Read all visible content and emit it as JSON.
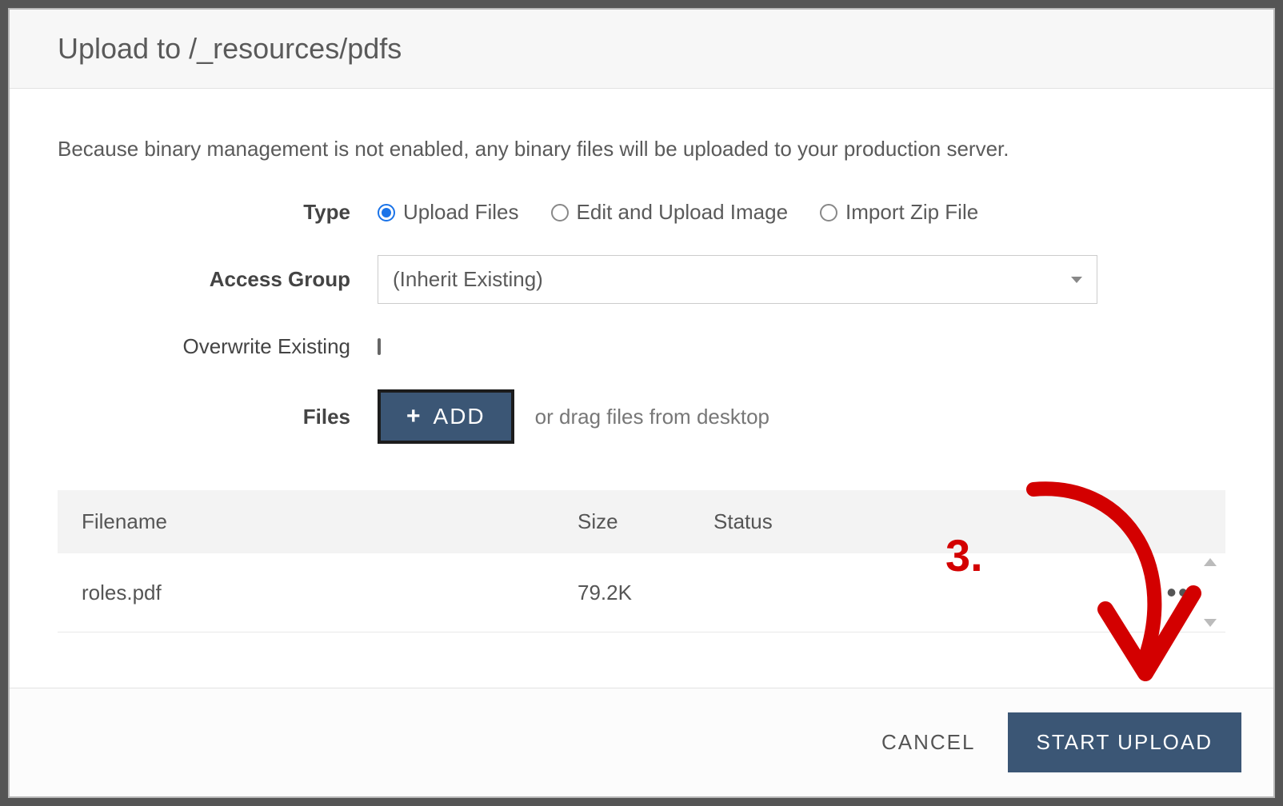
{
  "header": {
    "title": "Upload to /_resources/pdfs"
  },
  "notice": "Because binary management is not enabled, any binary files will be uploaded to your production server.",
  "form": {
    "type": {
      "label": "Type",
      "options": {
        "upload_files": "Upload Files",
        "edit_image": "Edit and Upload Image",
        "import_zip": "Import Zip File"
      },
      "selected": "upload_files"
    },
    "access_group": {
      "label": "Access Group",
      "value": "(Inherit Existing)"
    },
    "overwrite": {
      "label": "Overwrite Existing",
      "checked": false
    },
    "files": {
      "label": "Files",
      "add_button": "ADD",
      "drag_hint": "or drag files from desktop"
    }
  },
  "table": {
    "headers": {
      "filename": "Filename",
      "size": "Size",
      "status": "Status"
    },
    "rows": [
      {
        "filename": "roles.pdf",
        "size": "79.2K",
        "status": ""
      }
    ]
  },
  "footer": {
    "cancel": "CANCEL",
    "start": "START UPLOAD"
  },
  "annotation": {
    "step": "3."
  }
}
